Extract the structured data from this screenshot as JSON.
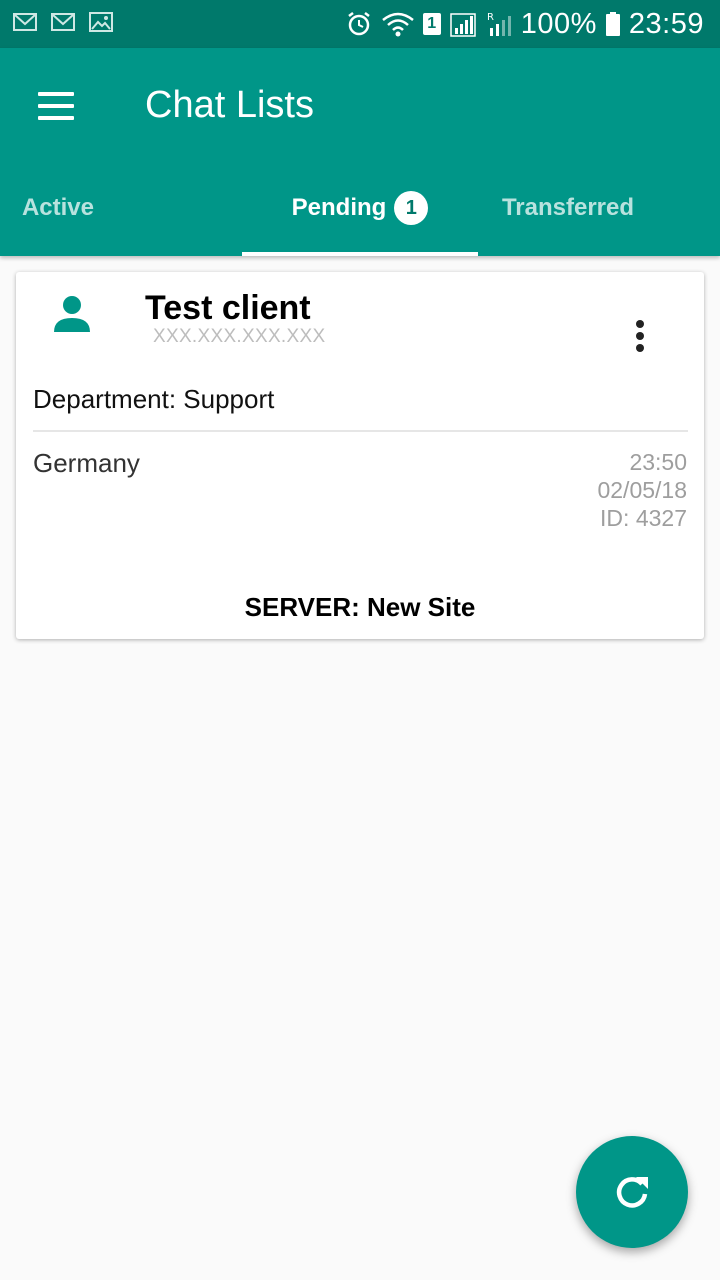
{
  "status_bar": {
    "notification_icons": [
      "gmail-icon",
      "gmail-icon",
      "gallery-icon"
    ],
    "sim_label": "1",
    "battery_percent": "100%",
    "time": "23:59"
  },
  "app_bar": {
    "title": "Chat Lists",
    "color": "#009688"
  },
  "tabs": [
    {
      "label": "Active",
      "selected": false
    },
    {
      "label": "Pending",
      "badge": "1",
      "selected": true
    },
    {
      "label": "Transferred",
      "selected": false
    }
  ],
  "chat_card": {
    "client_name": "Test client",
    "client_ip": "XXX.XXX.XXX.XXX",
    "department": "Department: Support",
    "country": "Germany",
    "time": "23:50",
    "date": "02/05/18",
    "id": "ID: 4327",
    "server": "SERVER: New Site"
  },
  "fab": {
    "icon": "refresh-icon"
  }
}
